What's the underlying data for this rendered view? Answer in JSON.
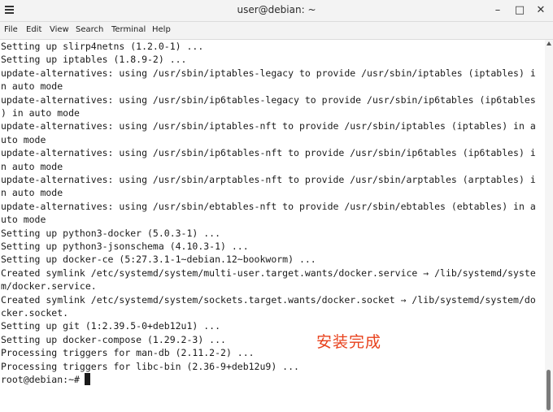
{
  "window": {
    "title": "user@debian: ~",
    "minimize": "–",
    "maximize": "□",
    "close": "✕"
  },
  "menu": [
    "File",
    "Edit",
    "View",
    "Search",
    "Terminal",
    "Help"
  ],
  "terminal": {
    "lines": [
      "Setting up slirp4netns (1.2.0-1) ...",
      "Setting up iptables (1.8.9-2) ...",
      "update-alternatives: using /usr/sbin/iptables-legacy to provide /usr/sbin/iptables (iptables) i",
      "n auto mode",
      "update-alternatives: using /usr/sbin/ip6tables-legacy to provide /usr/sbin/ip6tables (ip6tables",
      ") in auto mode",
      "update-alternatives: using /usr/sbin/iptables-nft to provide /usr/sbin/iptables (iptables) in a",
      "uto mode",
      "update-alternatives: using /usr/sbin/ip6tables-nft to provide /usr/sbin/ip6tables (ip6tables) i",
      "n auto mode",
      "update-alternatives: using /usr/sbin/arptables-nft to provide /usr/sbin/arptables (arptables) i",
      "n auto mode",
      "update-alternatives: using /usr/sbin/ebtables-nft to provide /usr/sbin/ebtables (ebtables) in a",
      "uto mode",
      "Setting up python3-docker (5.0.3-1) ...",
      "Setting up python3-jsonschema (4.10.3-1) ...",
      "Setting up docker-ce (5:27.3.1-1~debian.12~bookworm) ...",
      "Created symlink /etc/systemd/system/multi-user.target.wants/docker.service → /lib/systemd/syste",
      "m/docker.service.",
      "Created symlink /etc/systemd/system/sockets.target.wants/docker.socket → /lib/systemd/system/do",
      "cker.socket.",
      "Setting up git (1:2.39.5-0+deb12u1) ...",
      "Setting up docker-compose (1.29.2-3) ...",
      "Processing triggers for man-db (2.11.2-2) ...",
      "Processing triggers for libc-bin (2.36-9+deb12u9) ...",
      "root@debian:~# "
    ]
  },
  "annotation": "安装完成",
  "colors": {
    "annotation": "#e8411c",
    "text": "#1a1a1a",
    "titlebar": "#f3f3f3"
  }
}
